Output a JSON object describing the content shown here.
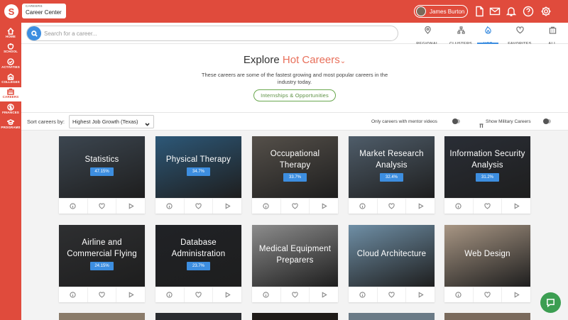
{
  "app": {
    "small_label": "CAREERS",
    "title": "Career Center",
    "logo_glyph": "S"
  },
  "user": {
    "name": "James Burton"
  },
  "top_icons": [
    "document-icon",
    "mail-icon",
    "bell-icon",
    "help-icon",
    "gear-icon"
  ],
  "sidebar": {
    "items": [
      {
        "label": "HOME",
        "icon": "home-icon"
      },
      {
        "label": "SCHOOL",
        "icon": "apple-icon"
      },
      {
        "label": "ACTIVITIES",
        "icon": "check-circle-icon"
      },
      {
        "label": "COLLEGES",
        "icon": "building-icon"
      },
      {
        "label": "CAREERS",
        "icon": "briefcase-icon",
        "active": true
      },
      {
        "label": "FINANCES",
        "icon": "dollar-icon"
      },
      {
        "label": "PROGRAMS",
        "icon": "graduation-cap-icon"
      }
    ]
  },
  "search": {
    "placeholder": "Search for a career..."
  },
  "nav_tabs": [
    {
      "label": "REGIONAL",
      "icon": "map-pin-icon"
    },
    {
      "label": "CLUSTERS",
      "icon": "sitemap-icon"
    },
    {
      "label": "HOT",
      "icon": "flame-icon",
      "active": true
    },
    {
      "label": "FAVORITES",
      "icon": "heart-icon"
    },
    {
      "label": "ALL",
      "icon": "building-icon"
    }
  ],
  "hero": {
    "title_prefix": "Explore",
    "title_accent": "Hot Careers",
    "title_chevron": "⌄",
    "description": "These careers are some of the fastest growing and most popular careers in the industry today.",
    "button_label": "Internships & Opportunities"
  },
  "sort": {
    "label": "Sort careers by:",
    "selected": "Highest Job Growth (Texas)",
    "mentor_toggle_label": "Only careers with mentor videos",
    "military_toggle_label": "Show Military Careers"
  },
  "colors": {
    "brand": "#e04b3c",
    "accent_blue": "#3d8ee0",
    "accent_green": "#6aa84f",
    "hero_accent": "#e8705b"
  },
  "cards": [
    {
      "title": "Statistics",
      "lines": [
        "Statistics"
      ],
      "badge": "47.15%",
      "bg": "#3c4650"
    },
    {
      "title": "Physical Therapy",
      "lines": [
        "Physical Therapy"
      ],
      "badge": "34.7%",
      "bg": "#2d5878"
    },
    {
      "title": "Occupational Therapy",
      "lines": [
        "Occupational",
        "Therapy"
      ],
      "badge": "33.7%",
      "bg": "#55504a"
    },
    {
      "title": "Market Research Analysis",
      "lines": [
        "Market Research",
        "Analysis"
      ],
      "badge": "32.4%",
      "bg": "#4f5d6a"
    },
    {
      "title": "Information Security Analysis",
      "lines": [
        "Information Security",
        "Analysis"
      ],
      "badge": "31.2%",
      "bg": "#2a2e36"
    },
    {
      "title": "Airline and Commercial Flying",
      "lines": [
        "Airline and",
        "Commercial Flying"
      ],
      "badge": "24.15%",
      "bg": "#2e2f31"
    },
    {
      "title": "Database Administration",
      "lines": [
        "Database",
        "Administration"
      ],
      "badge": "23.7%",
      "bg": "#202226"
    },
    {
      "title": "Medical Equipment Preparers",
      "lines": [
        "Medical Equipment",
        "Preparers"
      ],
      "badge": "",
      "bg": "#8c8c8c"
    },
    {
      "title": "Cloud Architecture",
      "lines": [
        "Cloud Architecture"
      ],
      "badge": "",
      "bg": "#6f8fa6"
    },
    {
      "title": "Web Design",
      "lines": [
        "Web Design"
      ],
      "badge": "",
      "bg": "#a89684"
    }
  ],
  "partial_cards": [
    {
      "bg": "#8a7b6a"
    },
    {
      "bg": "#2a2c30"
    },
    {
      "bg": "#1f1b18"
    },
    {
      "bg": "#6a7a86"
    },
    {
      "bg": "#7a6a5c"
    }
  ]
}
